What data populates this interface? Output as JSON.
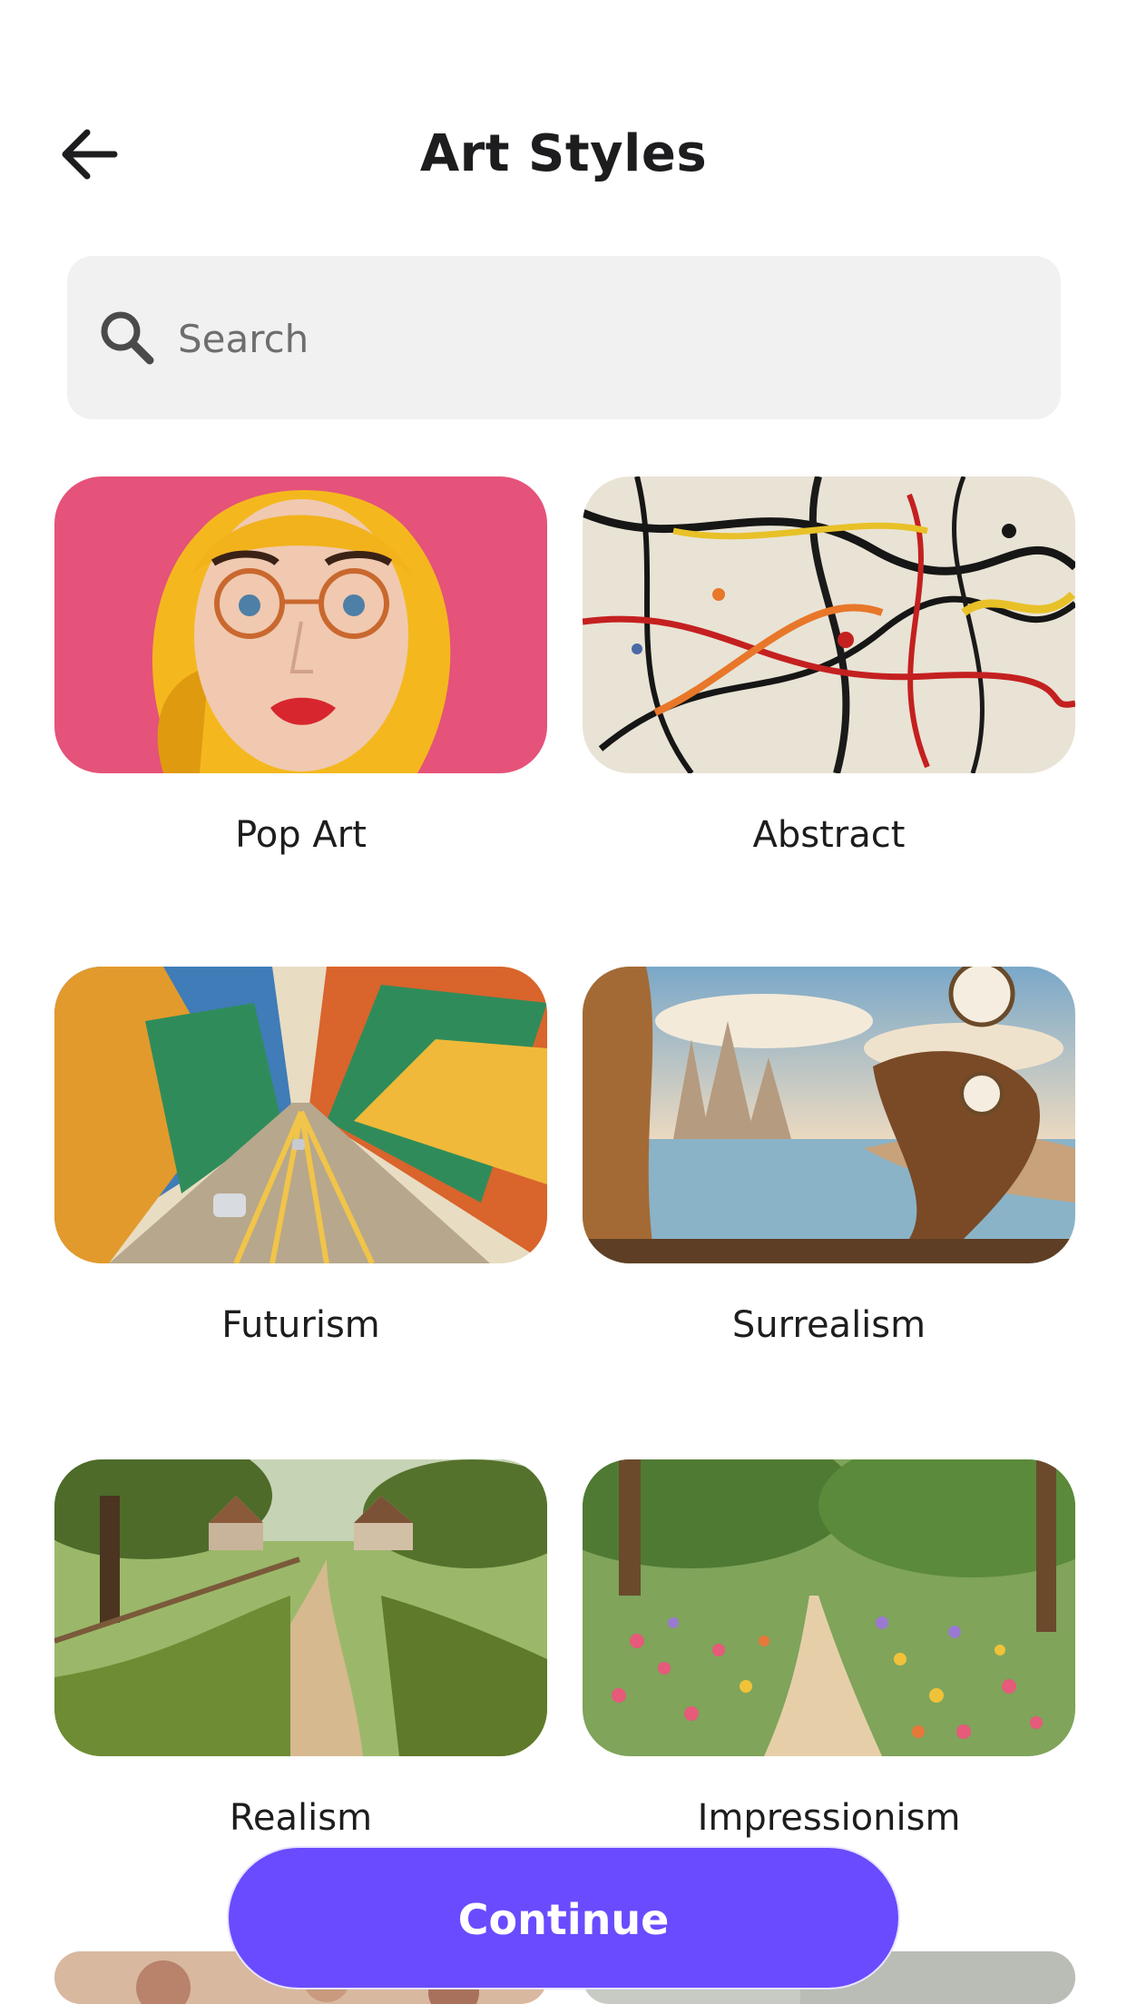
{
  "header": {
    "title": "Art Styles",
    "back_icon": "arrow-left-icon"
  },
  "search": {
    "placeholder": "Search",
    "value": "",
    "icon": "search-icon"
  },
  "styles": [
    {
      "label": "Pop Art"
    },
    {
      "label": "Abstract"
    },
    {
      "label": "Futurism"
    },
    {
      "label": "Surrealism"
    },
    {
      "label": "Realism"
    },
    {
      "label": "Impressionism"
    }
  ],
  "footer": {
    "continue_label": "Continue"
  },
  "colors": {
    "accent": "#6a4bff",
    "search_bg": "#f1f1f1",
    "text": "#1d1d1f"
  }
}
